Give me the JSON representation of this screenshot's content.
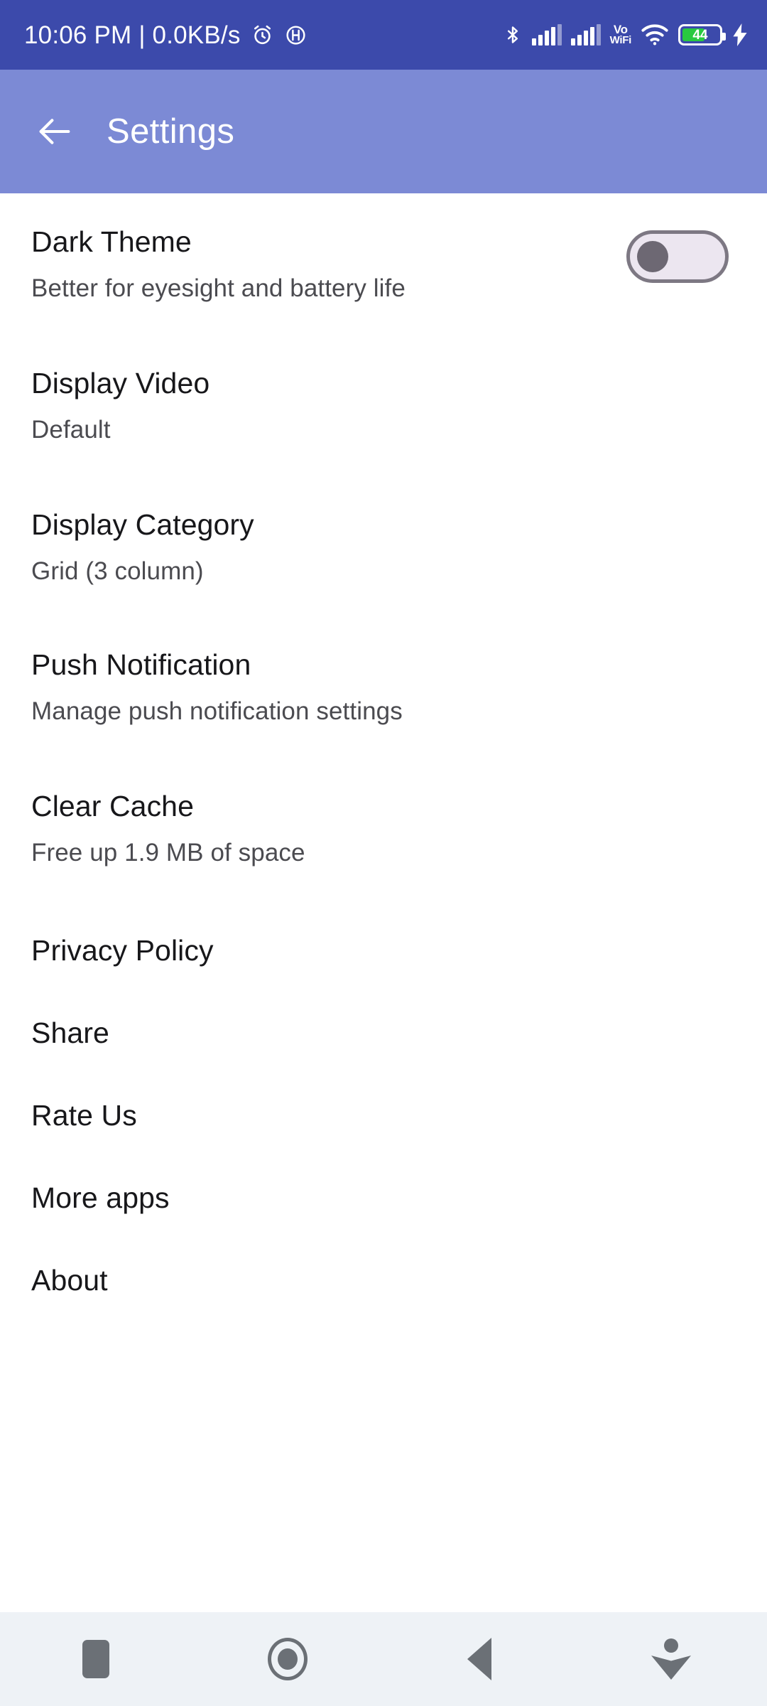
{
  "status_bar": {
    "clock_and_speed": "10:06 PM | 0.0KB/s",
    "alarm_icon": "alarm-clock-icon",
    "hd_icon": "hd-circle-icon",
    "bluetooth_icon": "bluetooth-icon",
    "signal_one_icon": "signal-bars-sim1-icon",
    "signal_two_icon": "signal-bars-sim2-icon",
    "vowifi_line1": "Vo",
    "vowifi_line2": "WiFi",
    "wifi_icon": "wifi-icon",
    "battery_percent": "44",
    "charging_icon": "charging-bolt-icon",
    "background_color": "#3c4aab"
  },
  "app_bar": {
    "back_label": "back-arrow",
    "title": "Settings",
    "background_color": "#7c8ad5",
    "text_color": "#ffffff"
  },
  "settings": {
    "items": [
      {
        "name": "dark-theme",
        "title": "Dark Theme",
        "subtitle": "Better for eyesight and battery life",
        "control": "toggle",
        "toggle_on": false
      },
      {
        "name": "display-video",
        "title": "Display Video",
        "subtitle": "Default",
        "control": "none"
      },
      {
        "name": "display-category",
        "title": "Display Category",
        "subtitle": "Grid (3 column)",
        "control": "none"
      },
      {
        "name": "push-notification",
        "title": "Push Notification",
        "subtitle": "Manage push notification settings",
        "control": "none"
      },
      {
        "name": "clear-cache",
        "title": "Clear Cache",
        "subtitle": "Free up 1.9 MB of space",
        "control": "none"
      },
      {
        "name": "privacy-policy",
        "title": "Privacy Policy",
        "subtitle": "",
        "control": "none"
      },
      {
        "name": "share",
        "title": "Share",
        "subtitle": "",
        "control": "none"
      },
      {
        "name": "rate-us",
        "title": "Rate Us",
        "subtitle": "",
        "control": "none"
      },
      {
        "name": "more-apps",
        "title": "More apps",
        "subtitle": "",
        "control": "none"
      },
      {
        "name": "about",
        "title": "About",
        "subtitle": "",
        "control": "none"
      }
    ],
    "title_color": "#17171a",
    "subtitle_color": "#4b4b50",
    "background_color": "#ffffff"
  },
  "nav_bar": {
    "recents_icon": "square-recents-icon",
    "home_icon": "circle-home-icon",
    "back_icon": "triangle-back-icon",
    "hide_icon": "hide-keyboard-icon",
    "background_color": "#eef2f6",
    "icon_color": "#6b7076"
  }
}
